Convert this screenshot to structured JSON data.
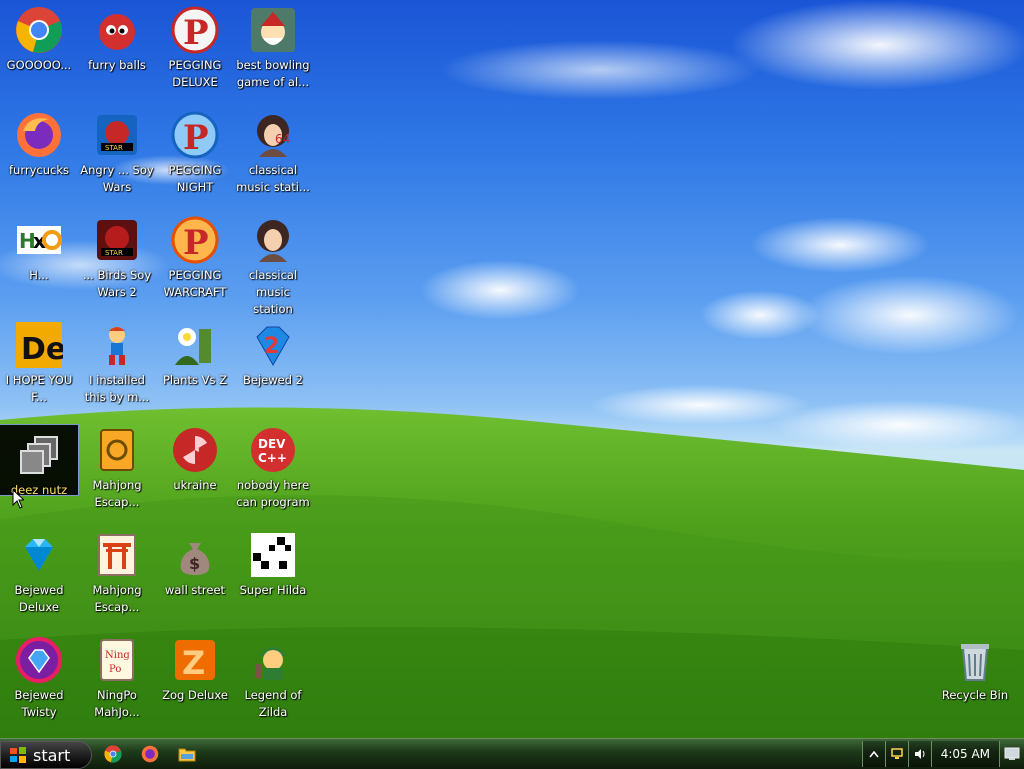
{
  "desktop": {
    "icons": [
      {
        "label": "GOOOOO...",
        "icon": "chrome-icon"
      },
      {
        "label": "furry balls",
        "icon": "red-fuzzball-icon"
      },
      {
        "label": "PEGGING DELUXE",
        "icon": "pegging-p-icon"
      },
      {
        "label": "best bowling game of al...",
        "icon": "santa-bowling-icon"
      },
      {
        "label": "furrycucks",
        "icon": "firefox-icon"
      },
      {
        "label": "Angry ... Soy Wars",
        "icon": "angry-birds-star-wars-icon"
      },
      {
        "label": "PEGGING NIGHT",
        "icon": "pegging-p-icon"
      },
      {
        "label": "classical music stati...",
        "icon": "classical-portrait-icon"
      },
      {
        "label": "H...",
        "icon": "hxd-icon"
      },
      {
        "label": "... Birds Soy Wars 2",
        "icon": "angry-birds-star-wars-2-icon"
      },
      {
        "label": "PEGGING WARCRAFT",
        "icon": "pegging-p-icon"
      },
      {
        "label": "classical music station",
        "icon": "classical-portrait-icon"
      },
      {
        "label": "I HOPE YOU F...",
        "icon": "de-icon"
      },
      {
        "label": "I installed this by m...",
        "icon": "runner-character-icon"
      },
      {
        "label": "Plants Vs Z",
        "icon": "plants-vs-zombies-icon"
      },
      {
        "label": "Bejewed 2",
        "icon": "bejeweled-2-icon"
      },
      {
        "label": "deez nutz",
        "icon": "windows-stack-icon"
      },
      {
        "label": "Mahjong Escap...",
        "icon": "mahjong-tile-icon"
      },
      {
        "label": "ukraine",
        "icon": "radiation-icon"
      },
      {
        "label": "nobody here can program",
        "icon": "dev-cpp-icon"
      },
      {
        "label": "Bejewed Deluxe",
        "icon": "diamond-gem-icon"
      },
      {
        "label": "Mahjong Escap...",
        "icon": "torii-gate-icon"
      },
      {
        "label": "wall street",
        "icon": "money-bag-icon"
      },
      {
        "label": "Super Hilda",
        "icon": "pixel-art-icon"
      },
      {
        "label": "Bejewed Twisty",
        "icon": "bejeweled-twist-icon"
      },
      {
        "label": "NingPo MahJo...",
        "icon": "ningpo-mahjong-icon"
      },
      {
        "label": "Zog Deluxe",
        "icon": "zog-z-icon"
      },
      {
        "label": "Legend of Zilda",
        "icon": "zelda-character-icon"
      },
      {
        "label": "Recycle Bin",
        "icon": "recycle-bin-icon"
      }
    ]
  },
  "taskbar": {
    "start_label": "start",
    "clock": "4:05 AM"
  },
  "colors": {
    "taskbar": "#1f3b1a",
    "sky": "#2f78e6",
    "grass": "#4f9a20"
  }
}
